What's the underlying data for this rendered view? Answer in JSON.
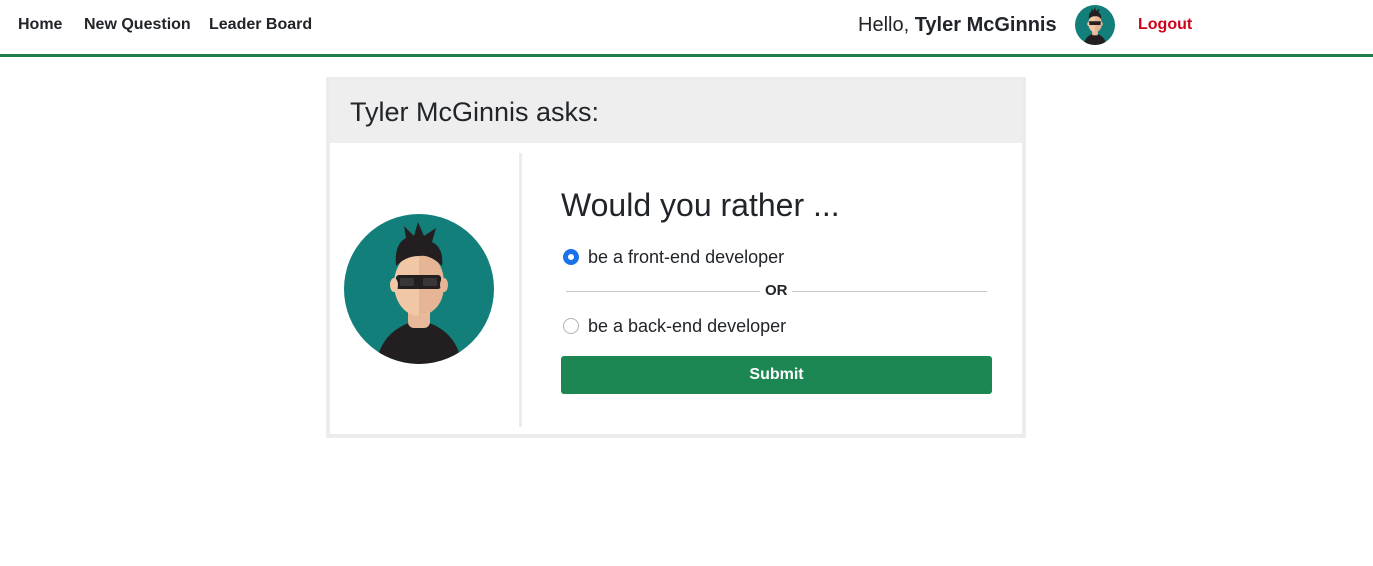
{
  "nav": {
    "items": [
      {
        "label": "Home"
      },
      {
        "label": "New Question"
      },
      {
        "label": "Leader Board"
      }
    ],
    "greeting_prefix": "Hello, ",
    "user_name": "Tyler McGinnis",
    "logout_label": "Logout",
    "accent_color": "#1e7e4a",
    "logout_color": "#d0021b"
  },
  "poll": {
    "header": "Tyler McGinnis asks:",
    "question": "Would you rather ...",
    "options": [
      {
        "label": "be a front-end developer",
        "selected": true
      },
      {
        "label": "be a back-end developer",
        "selected": false
      }
    ],
    "divider_text": "OR",
    "submit_label": "Submit",
    "avatar_icon": "user-avatar-sunglasses",
    "submit_color": "#1c8752"
  }
}
